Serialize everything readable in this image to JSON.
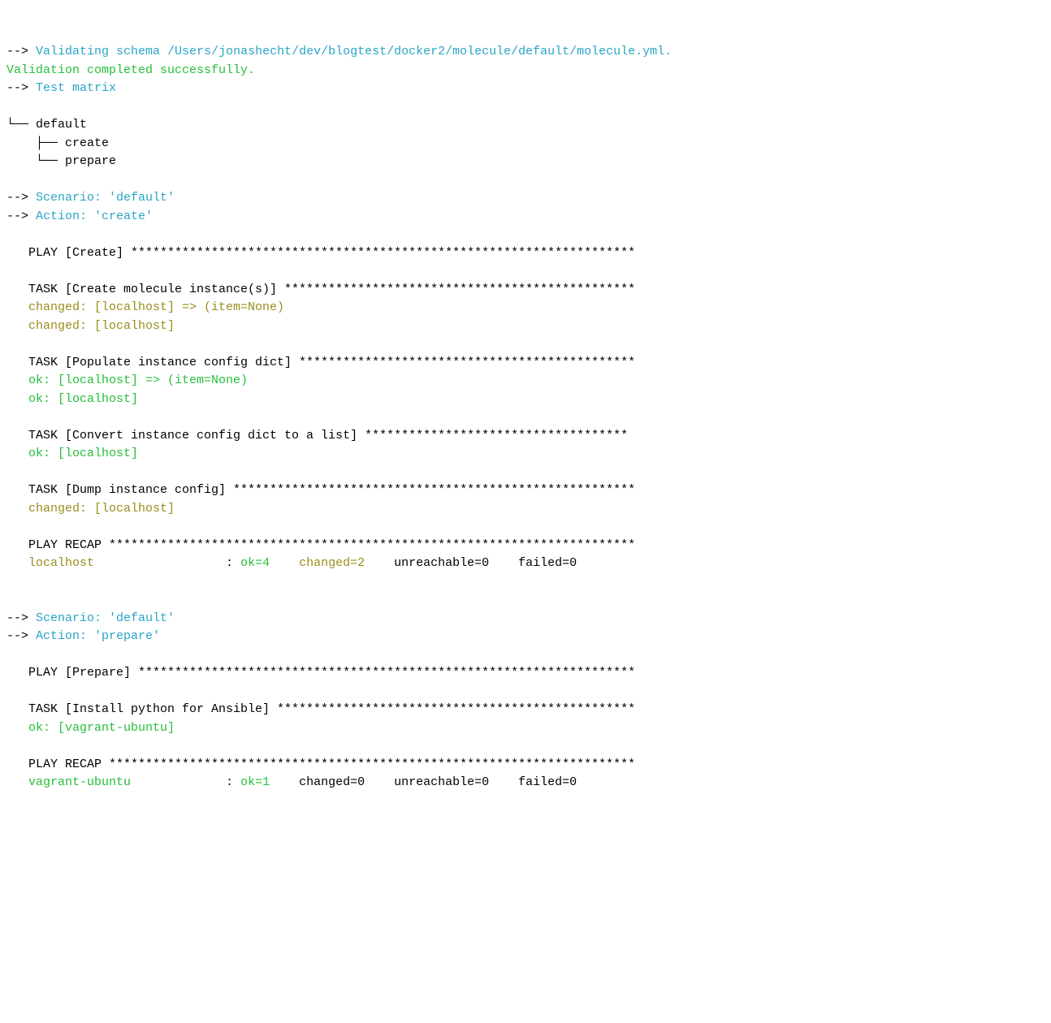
{
  "arrow": "-->",
  "validating": "Validating schema /Users/jonashecht/dev/blogtest/docker2/molecule/default/molecule.yml.",
  "validation_complete": "Validation completed successfully.",
  "test_matrix": "Test matrix",
  "tree_default": "└── default",
  "tree_create": "    ├── create",
  "tree_prepare": "    └── prepare",
  "scenario_default": "Scenario: 'default'",
  "action_create": "Action: 'create'",
  "action_prepare": "Action: 'prepare'",
  "play_create": "PLAY [Create] *********************************************************************",
  "task_create_instance": "TASK [Create molecule instance(s)] ************************************************",
  "changed_localhost_item": "changed: [localhost] => (item=None)",
  "changed_localhost": "changed: [localhost]",
  "task_populate": "TASK [Populate instance config dict] **********************************************",
  "ok_localhost_item": "ok: [localhost] => (item=None)",
  "ok_localhost": "ok: [localhost]",
  "task_convert": "TASK [Convert instance config dict to a list] ************************************",
  "task_dump": "TASK [Dump instance config] *******************************************************",
  "play_recap_header": "PLAY RECAP ************************************************************************",
  "recap1": {
    "host": "localhost                  ",
    "colon": ": ",
    "ok": "ok=4    ",
    "changed": "changed=2    ",
    "unreachable": "unreachable=0    ",
    "failed": "failed=0"
  },
  "play_prepare": "PLAY [Prepare] ********************************************************************",
  "task_install_python": "TASK [Install python for Ansible] *************************************************",
  "ok_vagrant": "ok: [vagrant-ubuntu]",
  "recap2": {
    "host": "vagrant-ubuntu             ",
    "colon": ": ",
    "ok": "ok=1    ",
    "changed": "changed=0    ",
    "unreachable": "unreachable=0    ",
    "failed": "failed=0"
  }
}
